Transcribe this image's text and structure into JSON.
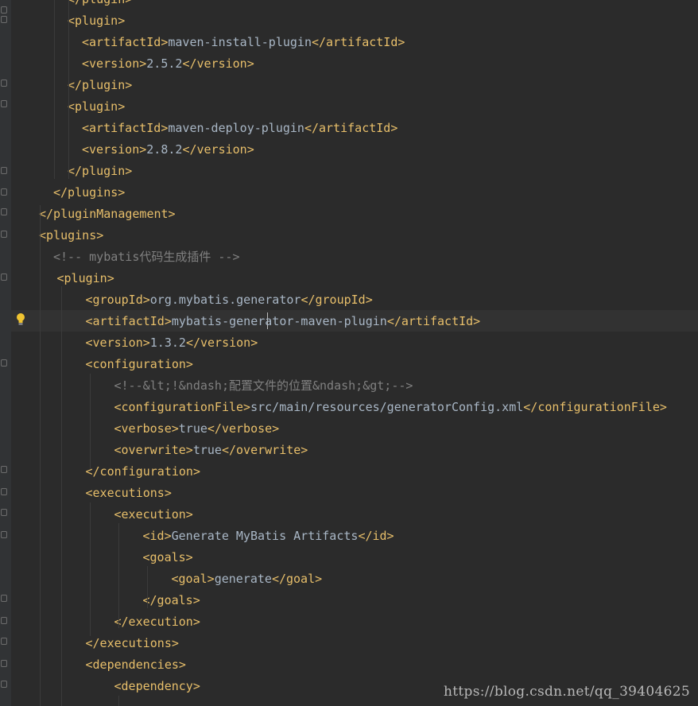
{
  "editor": {
    "lines": [
      {
        "indent": 5,
        "tokens": [
          {
            "k": "tag",
            "v": "</plugin>"
          }
        ]
      },
      {
        "indent": 5,
        "tokens": [
          {
            "k": "tag",
            "v": "<plugin>"
          }
        ]
      },
      {
        "indent": 7,
        "tokens": [
          {
            "k": "tag",
            "v": "<artifactId>"
          },
          {
            "k": "txt",
            "v": "maven-install-plugin"
          },
          {
            "k": "tag",
            "v": "</artifactId>"
          }
        ]
      },
      {
        "indent": 7,
        "tokens": [
          {
            "k": "tag",
            "v": "<version>"
          },
          {
            "k": "txt",
            "v": "2.5.2"
          },
          {
            "k": "tag",
            "v": "</version>"
          }
        ]
      },
      {
        "indent": 5,
        "tokens": [
          {
            "k": "tag",
            "v": "</plugin>"
          }
        ]
      },
      {
        "indent": 5,
        "tokens": [
          {
            "k": "tag",
            "v": "<plugin>"
          }
        ]
      },
      {
        "indent": 7,
        "tokens": [
          {
            "k": "tag",
            "v": "<artifactId>"
          },
          {
            "k": "txt",
            "v": "maven-deploy-plugin"
          },
          {
            "k": "tag",
            "v": "</artifactId>"
          }
        ]
      },
      {
        "indent": 7,
        "tokens": [
          {
            "k": "tag",
            "v": "<version>"
          },
          {
            "k": "txt",
            "v": "2.8.2"
          },
          {
            "k": "tag",
            "v": "</version>"
          }
        ]
      },
      {
        "indent": 5,
        "tokens": [
          {
            "k": "tag",
            "v": "</plugin>"
          }
        ]
      },
      {
        "indent": 3,
        "tokens": [
          {
            "k": "tag",
            "v": "</plugins>"
          }
        ]
      },
      {
        "indent": 1,
        "tokens": [
          {
            "k": "tag",
            "v": "</pluginManagement>"
          }
        ]
      },
      {
        "indent": 1,
        "tokens": [
          {
            "k": "tag",
            "v": "<plugins>"
          }
        ]
      },
      {
        "indent": 3,
        "tokens": [
          {
            "k": "cmt",
            "v": "<!-- mybatis代码生成插件 -->"
          }
        ]
      },
      {
        "indent": 3.5,
        "tokens": [
          {
            "k": "tag",
            "v": "<plugin>"
          }
        ]
      },
      {
        "indent": 7.5,
        "tokens": [
          {
            "k": "tag",
            "v": "<groupId>"
          },
          {
            "k": "txt",
            "v": "org.mybatis.generator"
          },
          {
            "k": "tag",
            "v": "</groupId>"
          }
        ]
      },
      {
        "indent": 7.5,
        "tokens": [
          {
            "k": "tag",
            "v": "<artifactId>"
          },
          {
            "k": "txt",
            "v": "mybatis-generator-maven-plugin"
          },
          {
            "k": "tag",
            "v": "</artifactId>"
          }
        ]
      },
      {
        "indent": 7.5,
        "tokens": [
          {
            "k": "tag",
            "v": "<version>"
          },
          {
            "k": "txt",
            "v": "1.3.2"
          },
          {
            "k": "tag",
            "v": "</version>"
          }
        ]
      },
      {
        "indent": 7.5,
        "tokens": [
          {
            "k": "tag",
            "v": "<configuration>"
          }
        ]
      },
      {
        "indent": 11.5,
        "tokens": [
          {
            "k": "cmt",
            "v": "<!--&lt;!&ndash;配置文件的位置&ndash;&gt;-->"
          }
        ]
      },
      {
        "indent": 11.5,
        "tokens": [
          {
            "k": "tag",
            "v": "<configurationFile>"
          },
          {
            "k": "txt",
            "v": "src/main/resources/generatorConfig.xml"
          },
          {
            "k": "tag",
            "v": "</configurationFile>"
          }
        ]
      },
      {
        "indent": 11.5,
        "tokens": [
          {
            "k": "tag",
            "v": "<verbose>"
          },
          {
            "k": "txt",
            "v": "true"
          },
          {
            "k": "tag",
            "v": "</verbose>"
          }
        ]
      },
      {
        "indent": 11.5,
        "tokens": [
          {
            "k": "tag",
            "v": "<overwrite>"
          },
          {
            "k": "txt",
            "v": "true"
          },
          {
            "k": "tag",
            "v": "</overwrite>"
          }
        ]
      },
      {
        "indent": 7.5,
        "tokens": [
          {
            "k": "tag",
            "v": "</configuration>"
          }
        ]
      },
      {
        "indent": 7.5,
        "tokens": [
          {
            "k": "tag",
            "v": "<executions>"
          }
        ]
      },
      {
        "indent": 11.5,
        "tokens": [
          {
            "k": "tag",
            "v": "<execution>"
          }
        ]
      },
      {
        "indent": 15.5,
        "tokens": [
          {
            "k": "tag",
            "v": "<id>"
          },
          {
            "k": "txt",
            "v": "Generate MyBatis Artifacts"
          },
          {
            "k": "tag",
            "v": "</id>"
          }
        ]
      },
      {
        "indent": 15.5,
        "tokens": [
          {
            "k": "tag",
            "v": "<goals>"
          }
        ]
      },
      {
        "indent": 19.5,
        "tokens": [
          {
            "k": "tag",
            "v": "<goal>"
          },
          {
            "k": "txt",
            "v": "generate"
          },
          {
            "k": "tag",
            "v": "</goal>"
          }
        ]
      },
      {
        "indent": 15.5,
        "tokens": [
          {
            "k": "tag",
            "v": "</goals>"
          }
        ]
      },
      {
        "indent": 11.5,
        "tokens": [
          {
            "k": "tag",
            "v": "</execution>"
          }
        ]
      },
      {
        "indent": 7.5,
        "tokens": [
          {
            "k": "tag",
            "v": "</executions>"
          }
        ]
      },
      {
        "indent": 7.5,
        "tokens": [
          {
            "k": "tag",
            "v": "<dependencies>"
          }
        ]
      },
      {
        "indent": 11.5,
        "tokens": [
          {
            "k": "tag",
            "v": "<dependency>"
          }
        ]
      }
    ],
    "caret_line": 15
  },
  "colors": {
    "background": "#2b2b2b",
    "tag": "#e8bf6a",
    "text": "#a9b7c6",
    "comment": "#808080"
  },
  "icons": {
    "intention": "lightbulb-icon",
    "fold": "fold-marker-icon"
  },
  "watermark": {
    "text": "https://blog.csdn.net/qq_39404625"
  }
}
